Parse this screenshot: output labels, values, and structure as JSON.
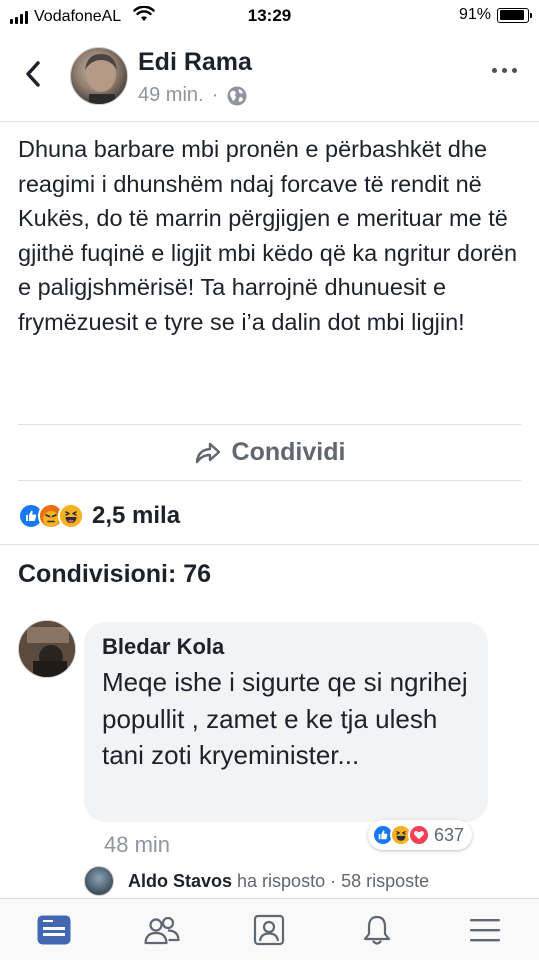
{
  "status_bar": {
    "carrier": "VodafoneAL",
    "time": "13:29",
    "battery_percent": "91%",
    "battery_level": 0.91
  },
  "header": {
    "author": "Edi Rama",
    "time_ago": "49 min.",
    "separator": "·",
    "privacy_icon": "globe-icon"
  },
  "post": {
    "text": "Dhuna barbare mbi pronën e përbashkët dhe reagimi i dhunshëm ndaj forcave të rendit në Kukës, do të marrin përgjigjen e merituar me të gjithë fuqinë e ligjit mbi këdo që ka ngritur dorën e paligjshmërisë! Ta harrojnë dhunuesit e frymëzuesit e tyre se i’a dalin dot mbi ligjin!",
    "share_label": "Condividi"
  },
  "reactions": {
    "icons": [
      "like-icon",
      "angry-icon",
      "haha-icon"
    ],
    "count": "2,5 mila"
  },
  "shares": {
    "title": "Condivisioni: 76"
  },
  "comment": {
    "author": "Bledar Kola",
    "text": "Meqe ishe i sigurte qe si ngrihej popullit , zamet e ke tja ulesh tani zoti kryeminister...",
    "time": "48 min",
    "reaction_icons": [
      "like-icon",
      "haha-icon",
      "love-icon"
    ],
    "reaction_count": "637"
  },
  "reply": {
    "name": "Aldo Stavos",
    "action": "ha risposto",
    "separator": "·",
    "replies": "58 risposte"
  },
  "tab_bar": {
    "tabs": [
      "news-feed-icon",
      "friends-icon",
      "profile-icon",
      "notifications-icon",
      "menu-icon"
    ],
    "active_color": "#4267b2",
    "inactive_color": "#606770"
  }
}
